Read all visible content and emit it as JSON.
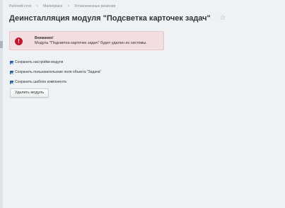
{
  "breadcrumb": {
    "items": [
      "Рабочий стол",
      "Marketplace",
      "Установленные решения"
    ]
  },
  "page": {
    "title": "Деинсталляция модуля \"Подсветка карточек задач\"",
    "star_icon": "star-icon"
  },
  "alert": {
    "title": "Внимание!",
    "text": "Модуль \"Подсветка карточек задач\" будет удален из системы.",
    "icon": "exclamation-icon",
    "icon_glyph": "!"
  },
  "options": [
    {
      "label": "Сохранить настройки модуля",
      "checked": true
    },
    {
      "label": "Сохранить пользовательские поля объекта \"Задача\"",
      "checked": true
    },
    {
      "label": "Сохранить шаблон компонента",
      "checked": true
    }
  ],
  "actions": {
    "uninstall_label": "Удалить модуль"
  },
  "colors": {
    "background": "#eef2f4",
    "alert_bg": "#f2dde1",
    "alert_icon": "#c4152b",
    "checkbox": "#2d6bb8"
  }
}
